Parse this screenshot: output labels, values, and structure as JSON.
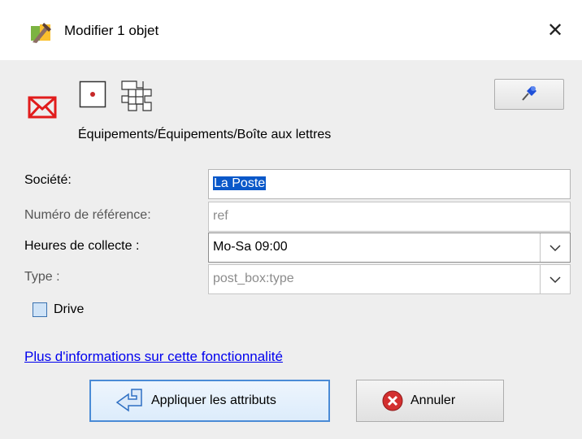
{
  "window": {
    "title": "Modifier 1 objet",
    "close_glyph": "✕"
  },
  "preset": {
    "path": "Équipements/Équipements/Boîte aux lettres",
    "icons": [
      "mailbox-icon",
      "node-icon",
      "area-grid-icon",
      "pin-icon"
    ]
  },
  "fields": {
    "operator": {
      "label": "Société:",
      "value": "La Poste"
    },
    "ref": {
      "label": "Numéro de référence:",
      "placeholder": "ref"
    },
    "collection_times": {
      "label": "Heures de collecte :",
      "value": "Mo-Sa 09:00"
    },
    "type": {
      "label": "Type :",
      "placeholder": "post_box:type"
    },
    "drive": {
      "label": "Drive",
      "checked": false
    }
  },
  "link": {
    "text": "Plus d'informations sur cette fonctionnalité"
  },
  "buttons": {
    "apply": "Appliquer les attributs",
    "cancel": "Annuler"
  },
  "colors": {
    "link": "#0000ee",
    "selection": "#0a58c9",
    "mail_red": "#e11c1c",
    "default_border": "#4a8bd6"
  }
}
